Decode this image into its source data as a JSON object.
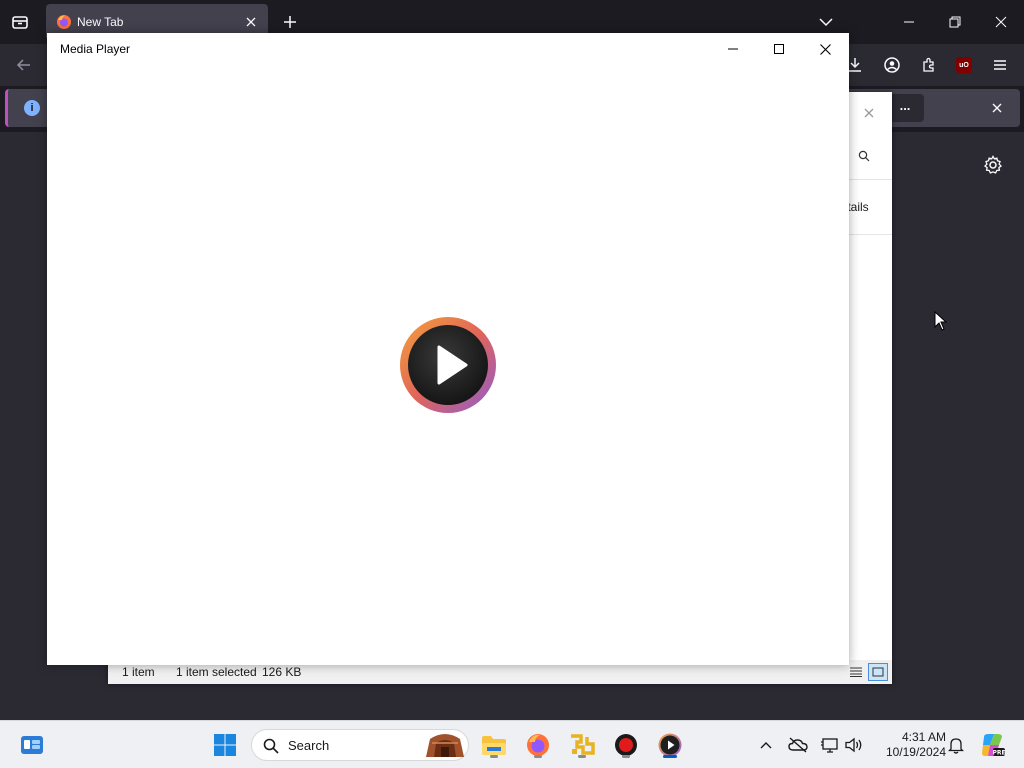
{
  "browser": {
    "tab_title": "New Tab",
    "notification_ellipsis": "..."
  },
  "explorer": {
    "details_text": "Details",
    "status_count": "1 item",
    "status_selected": "1 item selected",
    "status_size": "126 KB"
  },
  "media_player": {
    "title": "Media Player"
  },
  "taskbar": {
    "search_placeholder": "Search",
    "time": "4:31 AM",
    "date": "10/19/2024",
    "pinned_apps": [
      "file-explorer",
      "firefox",
      "app-yellow",
      "recorder",
      "media-player"
    ]
  },
  "colors": {
    "firefox_dark": "#2b2a33",
    "taskbar_bg": "#eef0f4",
    "accent_blue": "#005fb8",
    "media_logo_ring_start": "#f08a3c",
    "media_logo_ring_end": "#9a5cc7"
  }
}
